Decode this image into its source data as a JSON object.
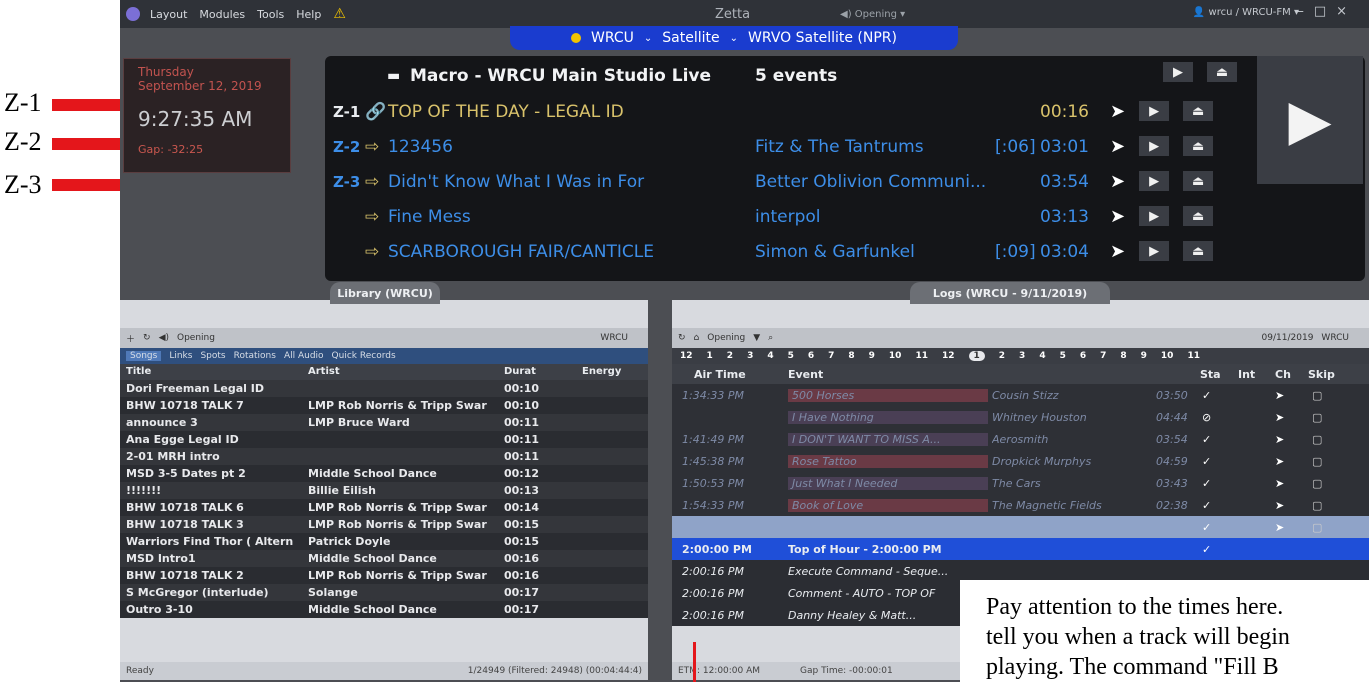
{
  "annotations": [
    {
      "label": "Z-1"
    },
    {
      "label": "Z-2"
    },
    {
      "label": "Z-3"
    }
  ],
  "menu": [
    "Layout",
    "Modules",
    "Tools",
    "Help"
  ],
  "app_title": "Zetta",
  "top_mode": "Opening",
  "user": "wrcu / WRCU-FM",
  "station_bar": {
    "station": "WRCU",
    "source": "Satellite",
    "feed": "WRVO Satellite (NPR)"
  },
  "clock": {
    "day": "Thursday",
    "date": "September 12, 2019",
    "time": "9:27:35 AM",
    "gap": "Gap: -32:25"
  },
  "player": {
    "header": {
      "title": "Macro - WRCU Main Studio Live",
      "events": "5 events"
    },
    "rows": [
      {
        "z": "Z-1",
        "title": "TOP OF THE DAY - LEGAL ID",
        "artist": "",
        "lead": "",
        "dur": "00:16",
        "color": "#d9c26b"
      },
      {
        "z": "Z-2",
        "title": "123456",
        "artist": "Fitz & The Tantrums",
        "lead": "[:06]",
        "dur": "03:01",
        "color": "#3d8ee8"
      },
      {
        "z": "Z-3",
        "title": "Didn't Know What I Was in For",
        "artist": "Better Oblivion Communi...",
        "lead": "",
        "dur": "03:54",
        "color": "#3d8ee8"
      },
      {
        "z": "",
        "title": "Fine Mess",
        "artist": "interpol",
        "lead": "",
        "dur": "03:13",
        "color": "#3d8ee8"
      },
      {
        "z": "",
        "title": "SCARBOROUGH FAIR/CANTICLE",
        "artist": "Simon & Garfunkel",
        "lead": "[:09]",
        "dur": "03:04",
        "color": "#3d8ee8"
      }
    ]
  },
  "library": {
    "title": "Library (WRCU)",
    "toolbar": {
      "mode": "Opening",
      "station": "WRCU"
    },
    "tabs": [
      "Songs",
      "Links",
      "Spots",
      "Rotations",
      "All Audio",
      "Quick Records"
    ],
    "columns": [
      "Title",
      "Artist",
      "Durat",
      "Energy"
    ],
    "rows": [
      [
        "Dori Freeman Legal ID",
        "",
        "00:10"
      ],
      [
        "BHW 10718 TALK 7",
        "LMP Rob Norris & Tripp Swar",
        "00:10"
      ],
      [
        "announce 3",
        "LMP Bruce Ward",
        "00:11"
      ],
      [
        "Ana Egge Legal ID",
        "",
        "00:11"
      ],
      [
        "2-01 MRH intro",
        "",
        "00:11"
      ],
      [
        "MSD 3-5 Dates pt 2",
        "Middle School Dance",
        "00:12"
      ],
      [
        "!!!!!!!",
        "Billie Eilish",
        "00:13"
      ],
      [
        "BHW 10718 TALK 6",
        "LMP Rob Norris & Tripp Swar",
        "00:14"
      ],
      [
        "BHW 10718 TALK 3",
        "LMP Rob Norris & Tripp Swar",
        "00:15"
      ],
      [
        "Warriors Find Thor ( Altern",
        "Patrick Doyle",
        "00:15"
      ],
      [
        "MSD Intro1",
        "Middle School Dance",
        "00:16"
      ],
      [
        "BHW 10718 TALK 2",
        "LMP Rob Norris & Tripp Swar",
        "00:16"
      ],
      [
        "S McGregor (interlude)",
        "Solange",
        "00:17"
      ],
      [
        "Outro 3-10",
        "Middle School Dance",
        "00:17"
      ]
    ],
    "status_left": "Ready",
    "status_right": "1/24949 (Filtered: 24948) (00:04:44:4)"
  },
  "logs": {
    "title": "Logs (WRCU - 9/11/2019)",
    "toolbar": {
      "mode": "Opening",
      "date": "09/11/2019",
      "station": "WRCU"
    },
    "days": [
      "12",
      "1",
      "2",
      "3",
      "4",
      "5",
      "6",
      "7",
      "8",
      "9",
      "10",
      "11",
      "12",
      "1",
      "2",
      "3",
      "4",
      "5",
      "6",
      "7",
      "8",
      "9",
      "10",
      "11"
    ],
    "selected_day": "1",
    "columns": [
      "Air Time",
      "Event",
      "Sta",
      "Int",
      "Ch",
      "Skip"
    ],
    "rows": [
      [
        "1:34:33 PM",
        "500 Horses",
        "Cousin Stizz",
        "03:50",
        "#6a3a45"
      ],
      [
        "",
        "I Have Nothing",
        "Whitney Houston",
        "04:44",
        "#4a3f55"
      ],
      [
        "1:41:49 PM",
        "I DON'T WANT TO MISS A...",
        "Aerosmith",
        "03:54",
        "#4a3f55"
      ],
      [
        "1:45:38 PM",
        "Rose Tattoo",
        "Dropkick Murphys",
        "04:59",
        "#6a3a45"
      ],
      [
        "1:50:53 PM",
        "Just What I Needed",
        "The Cars",
        "03:43",
        "#4a3f55"
      ],
      [
        "1:54:33 PM",
        "Book of Love",
        "The Magnetic Fields",
        "02:38",
        "#6a3a45"
      ],
      [
        "",
        "",
        "",
        "",
        "#8fa3c8"
      ],
      [
        "2:00:00 PM",
        "Top of Hour - 2:00:00 PM",
        "",
        "",
        "#1f4fd8"
      ],
      [
        "2:00:16 PM",
        "Execute Command - Seque...",
        "",
        "",
        "#3a3d44"
      ],
      [
        "2:00:16 PM",
        "Comment - AUTO - TOP OF",
        "",
        "",
        "#3a3d44"
      ],
      [
        "2:00:16 PM",
        "Danny Healey & Matt...",
        "",
        "",
        "#3a3d44"
      ]
    ],
    "status_left": "ETM: 12:00:00 AM",
    "status_right": "Gap Time: -00:00:01"
  },
  "note": {
    "line1": "Pay attention to the times here.",
    "line2": "tell you when a track will begin",
    "line3": "playing. The command \"Fill B"
  }
}
